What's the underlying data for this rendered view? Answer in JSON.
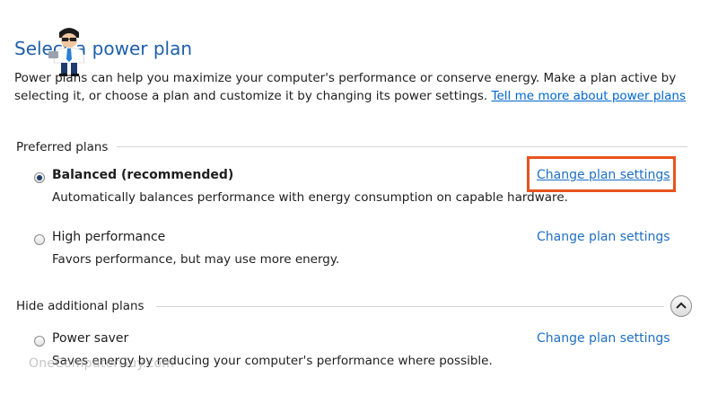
{
  "header": {
    "title": "Select a power plan",
    "description_text": "Power plans can help you maximize your computer's performance or conserve energy. Make a plan active by selecting it, or choose a plan and customize it by changing its power settings.",
    "help_link": "Tell me more about power plans"
  },
  "preferred_section": {
    "label": "Preferred plans",
    "plans": [
      {
        "name": "Balanced (recommended)",
        "description": "Automatically balances performance with energy consumption on capable hardware.",
        "link": "Change plan settings",
        "selected": true
      },
      {
        "name": "High performance",
        "description": "Favors performance, but may use more energy.",
        "link": "Change plan settings",
        "selected": false
      }
    ]
  },
  "additional_section": {
    "label": "Hide additional plans",
    "toggle_icon": "chevron-up-icon",
    "plans": [
      {
        "name": "Power saver",
        "description": "Saves energy by reducing your computer's performance where possible.",
        "link": "Change plan settings",
        "selected": false
      }
    ]
  },
  "watermark": {
    "text": "OneComputerGuy.com"
  },
  "colors": {
    "title": "#1e5fa8",
    "link": "#1e6fc3",
    "highlight": "#e8531f"
  }
}
